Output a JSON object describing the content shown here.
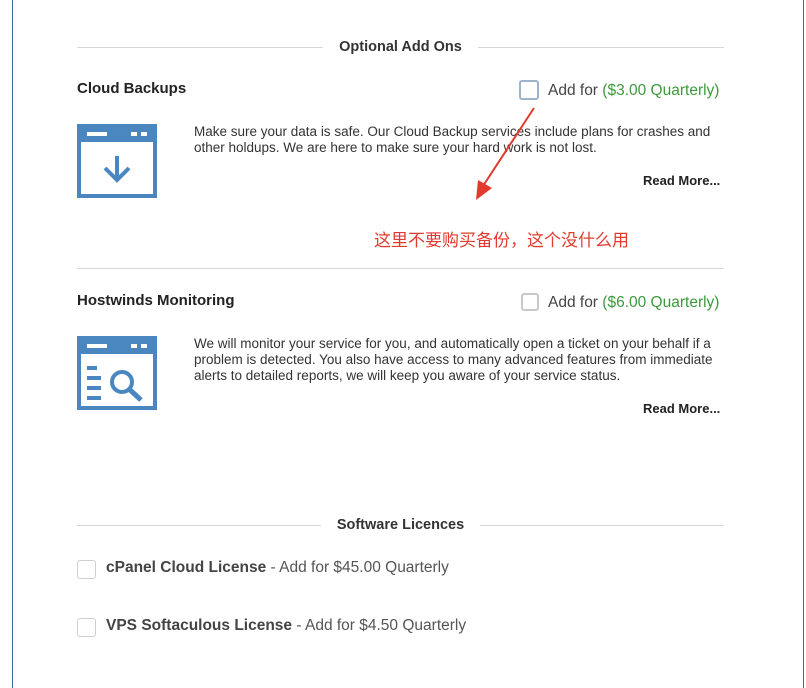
{
  "optional_addons": {
    "heading": "Optional Add Ons",
    "items": [
      {
        "name": "Cloud Backups",
        "add_label": "Add for",
        "price": "($3.00 Quarterly)",
        "description": "Make sure your data is safe. Our Cloud Backup services include plans for crashes and other holdups. We are here to make sure your hard work is not lost.",
        "read_more": "Read More...",
        "icon": "download-window-icon"
      },
      {
        "name": "Hostwinds Monitoring",
        "add_label": "Add for",
        "price": "($6.00 Quarterly)",
        "description": "We will monitor your service for you, and automatically open a ticket on your behalf if a problem is detected. You also have access to many advanced features from immediate alerts to detailed reports, we will keep you aware of your service status.",
        "read_more": "Read More...",
        "icon": "monitor-search-window-icon"
      }
    ]
  },
  "annotation": {
    "text": "这里不要购买备份，这个没什么用",
    "color": "#e23b2e"
  },
  "software_licences": {
    "heading": "Software Licences",
    "items": [
      {
        "name": "cPanel Cloud License",
        "suffix": " - Add for $45.00 Quarterly"
      },
      {
        "name": "VPS Softaculous License",
        "suffix": " - Add for $4.50 Quarterly"
      }
    ]
  },
  "colors": {
    "accent_blue": "#4a87c0",
    "price_green": "#3c9a3c"
  }
}
